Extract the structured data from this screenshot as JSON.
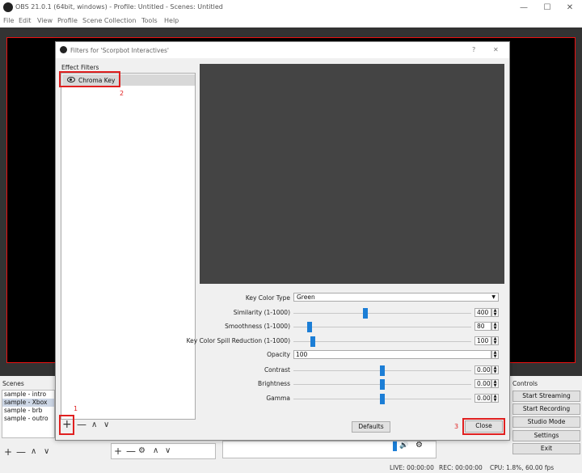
{
  "window": {
    "title": "OBS 21.0.1 (64bit, windows) - Profile: Untitled - Scenes: Untitled",
    "minimize": "—",
    "maximize": "☐",
    "close": "✕"
  },
  "menu": [
    "File",
    "Edit",
    "View",
    "Profile",
    "Scene Collection",
    "Tools",
    "Help"
  ],
  "scenes": {
    "label": "Scenes",
    "items": [
      "sample - intro",
      "sample - Xbox",
      "sample - brb",
      "sample - outro"
    ],
    "selected_index": 1,
    "toolbar": [
      "+",
      "—",
      "∧",
      "∨"
    ]
  },
  "sources_toolbar": [
    "+",
    "—",
    "⚙",
    "∧",
    "∨"
  ],
  "controls": {
    "label": "Controls",
    "buttons": [
      "Start Streaming",
      "Start Recording",
      "Studio Mode",
      "Settings",
      "Exit"
    ]
  },
  "status": {
    "live": "LIVE: 00:00:00",
    "rec": "REC: 00:00:00",
    "cpu": "CPU: 1.8%, 60.00 fps"
  },
  "dialog": {
    "title": "Filters for 'Scorpbot Interactives'",
    "help": "?",
    "close_x": "✕",
    "effect_filters_label": "Effect Filters",
    "filters": [
      "Chroma Key"
    ],
    "list_toolbar": [
      "+",
      "—",
      "∧",
      "∨"
    ],
    "defaults_label": "Defaults",
    "close_label": "Close",
    "annotations": [
      "1",
      "2",
      "3"
    ],
    "properties": {
      "key_color_type": {
        "label": "Key Color Type",
        "value": "Green"
      },
      "similarity": {
        "label": "Similarity (1-1000)",
        "value": "400",
        "fraction": 0.4
      },
      "smoothness": {
        "label": "Smoothness (1-1000)",
        "value": "80",
        "fraction": 0.08
      },
      "spill": {
        "label": "Key Color Spill Reduction (1-1000)",
        "value": "100",
        "fraction": 0.1
      },
      "opacity": {
        "label": "Opacity",
        "value": "100"
      },
      "contrast": {
        "label": "Contrast",
        "value": "0.00",
        "fraction": 0.5
      },
      "brightness": {
        "label": "Brightness",
        "value": "0.00",
        "fraction": 0.5
      },
      "gamma": {
        "label": "Gamma",
        "value": "0.00",
        "fraction": 0.5
      }
    }
  },
  "colors": {
    "accent": "#1c7ed6",
    "annotation_red": "#e02020",
    "preview_bg": "#444444"
  }
}
